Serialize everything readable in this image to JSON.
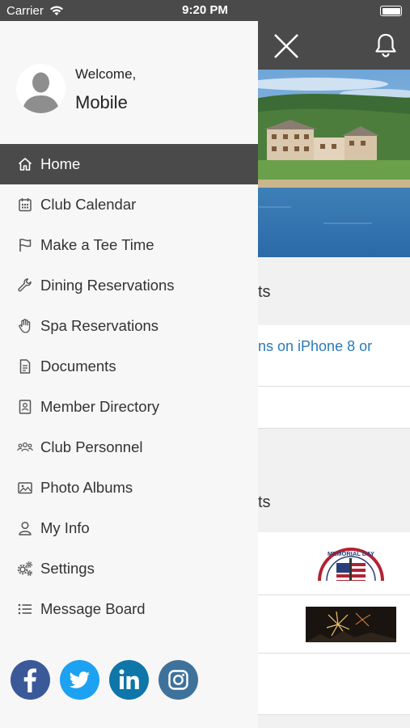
{
  "status_bar": {
    "carrier": "Carrier",
    "time": "9:20 PM"
  },
  "drawer": {
    "welcome": "Welcome,",
    "username": "Mobile",
    "menu": [
      {
        "label": "Home",
        "icon": "home-icon",
        "active": true
      },
      {
        "label": "Club Calendar",
        "icon": "calendar-icon"
      },
      {
        "label": "Make a Tee Time",
        "icon": "flag-icon"
      },
      {
        "label": "Dining Reservations",
        "icon": "wrench-icon"
      },
      {
        "label": "Spa Reservations",
        "icon": "hand-icon"
      },
      {
        "label": "Documents",
        "icon": "document-icon"
      },
      {
        "label": "Member Directory",
        "icon": "contact-book-icon"
      },
      {
        "label": "Club Personnel",
        "icon": "people-icon"
      },
      {
        "label": "Photo Albums",
        "icon": "image-icon"
      },
      {
        "label": "My Info",
        "icon": "user-icon"
      },
      {
        "label": "Settings",
        "icon": "gears-icon"
      },
      {
        "label": "Message Board",
        "icon": "list-icon"
      }
    ],
    "social": [
      {
        "name": "facebook-icon",
        "color": "#3b5998"
      },
      {
        "name": "twitter-icon",
        "color": "#1da1f2"
      },
      {
        "name": "linkedin-icon",
        "color": "#0e76a8"
      },
      {
        "name": "instagram-icon",
        "color": "#3f729b"
      }
    ]
  },
  "background": {
    "section1_heading": "ts",
    "announcement": "ns on iPhone 8 or",
    "section2_heading": "ts",
    "memorial_badge_text": "MEMORIAL DAY"
  },
  "colors": {
    "dark_bar": "#4a4a4a",
    "active_item": "#4a4a4a",
    "link": "#2a7bb8",
    "drawer_bg": "#f7f7f7"
  }
}
